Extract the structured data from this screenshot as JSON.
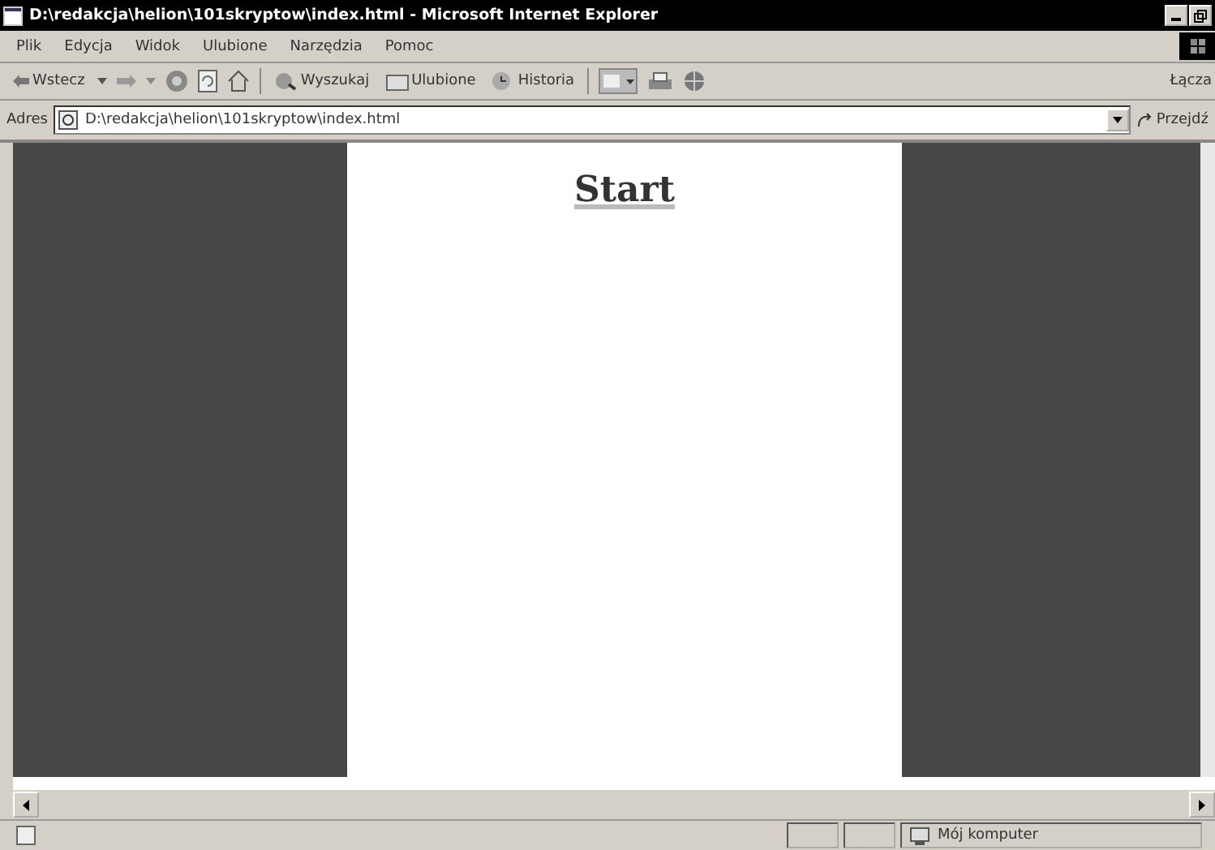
{
  "window": {
    "title": "D:\\redakcja\\helion\\101skryptow\\index.html - Microsoft Internet Explorer"
  },
  "menu": [
    "Plik",
    "Edycja",
    "Widok",
    "Ulubione",
    "Narzędzia",
    "Pomoc"
  ],
  "toolbar": {
    "back": "Wstecz",
    "buttons": [
      {
        "kind": "search",
        "label": "Wyszukaj"
      },
      {
        "kind": "favorites",
        "label": "Ulubione"
      },
      {
        "kind": "history",
        "label": "Historia"
      }
    ],
    "links": "Łącza"
  },
  "address": {
    "label": "Adres",
    "value": "D:\\redakcja\\helion\\101skryptow\\index.html",
    "go": "Przejdź"
  },
  "page": {
    "heading": "Start"
  },
  "status_bar": {
    "zone": "Mój komputer"
  }
}
